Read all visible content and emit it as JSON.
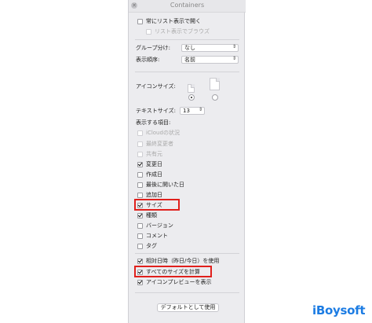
{
  "window": {
    "title": "Containers"
  },
  "options": {
    "list_view_open": "常にリスト表示で開く",
    "list_view_browse": "リスト表示でブラウズ"
  },
  "group_by": {
    "label": "グループ分け:",
    "value": "なし"
  },
  "sort_by": {
    "label": "表示順序:",
    "value": "名前"
  },
  "icon_size": {
    "label": "アイコンサイズ:"
  },
  "text_size": {
    "label": "テキストサイズ:",
    "value": "13"
  },
  "show_columns": {
    "label": "表示する項目:",
    "items": [
      {
        "label": "iCloudの状況",
        "checked": false,
        "disabled": true
      },
      {
        "label": "最終変更者",
        "checked": false,
        "disabled": true
      },
      {
        "label": "共有元",
        "checked": false,
        "disabled": true
      },
      {
        "label": "変更日",
        "checked": true,
        "disabled": false
      },
      {
        "label": "作成日",
        "checked": false,
        "disabled": false
      },
      {
        "label": "最後に開いた日",
        "checked": false,
        "disabled": false
      },
      {
        "label": "追加日",
        "checked": false,
        "disabled": false
      },
      {
        "label": "サイズ",
        "checked": true,
        "disabled": false
      },
      {
        "label": "種類",
        "checked": true,
        "disabled": false
      },
      {
        "label": "バージョン",
        "checked": false,
        "disabled": false
      },
      {
        "label": "コメント",
        "checked": false,
        "disabled": false
      },
      {
        "label": "タグ",
        "checked": false,
        "disabled": false
      }
    ]
  },
  "bottom_options": [
    {
      "label": "相対日時（昨日/今日）を使用",
      "checked": true
    },
    {
      "label": "すべてのサイズを計算",
      "checked": true
    },
    {
      "label": "アイコンプレビューを表示",
      "checked": true
    }
  ],
  "default_button": "デフォルトとして使用",
  "watermark": "iBoysoft",
  "colors": {
    "highlight": "#e0201c",
    "logo": "#1c7ce3"
  }
}
